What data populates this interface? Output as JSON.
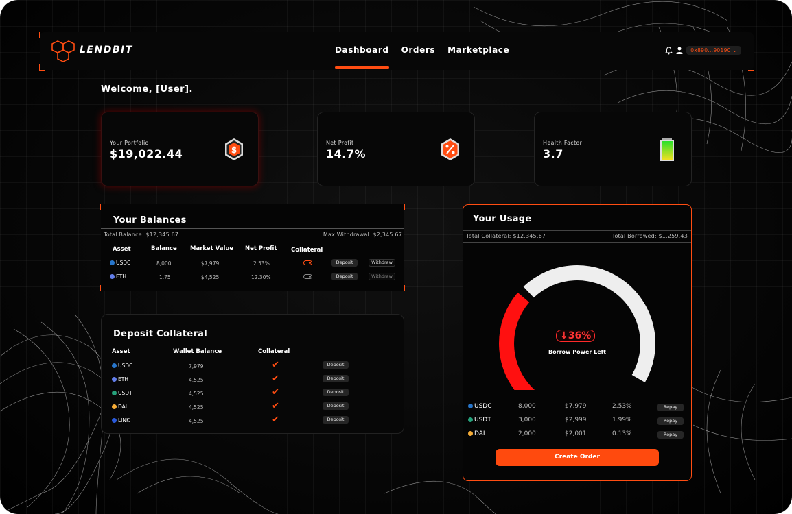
{
  "app": {
    "brand": "LENDBIT"
  },
  "nav": {
    "tabs": [
      {
        "label": "Dashboard"
      },
      {
        "label": "Orders"
      },
      {
        "label": "Marketplace"
      }
    ],
    "wallet": "0x890...90190 ⌄",
    "accent": "#ff4d12"
  },
  "welcome": "Welcome, [User].",
  "stats": {
    "portfolio": {
      "label": "Your Portfolio",
      "value": "$19,022.44",
      "icon": "dollar-hex-icon"
    },
    "profit": {
      "label": "Net Profit",
      "value": "14.7%",
      "icon": "percent-hex-icon"
    },
    "health": {
      "label": "Health Factor",
      "value": "3.7",
      "icon": "battery-icon"
    }
  },
  "balances": {
    "title": "Your Balances",
    "total": "Total Balance: $12,345.67",
    "max": "Max Withdrawal: $2,345.67",
    "headers": [
      "Asset",
      "Balance",
      "Market Value",
      "Net Profit",
      "Collateral"
    ],
    "rows": [
      {
        "asset": "USDC",
        "balance": "8,000",
        "market": "$7,979",
        "profit": "2.53%",
        "collateral_on": true,
        "deposit": "Deposit",
        "withdraw": "Withdraw"
      },
      {
        "asset": "ETH",
        "balance": "1.75",
        "market": "$4,525",
        "profit": "12.30%",
        "collateral_on": false,
        "deposit": "Deposit",
        "withdraw": "Withdraw"
      }
    ]
  },
  "deposit": {
    "title": "Deposit Collateral",
    "headers": [
      "Asset",
      "Wallet Balance",
      "Collateral"
    ],
    "rows": [
      {
        "asset": "USDC",
        "balance": "7,979",
        "btn": "Deposit",
        "color": "#2775ca"
      },
      {
        "asset": "ETH",
        "balance": "4,525",
        "btn": "Deposit",
        "color": "#627eea"
      },
      {
        "asset": "USDT",
        "balance": "4,525",
        "btn": "Deposit",
        "color": "#26a17b"
      },
      {
        "asset": "DAI",
        "balance": "4,525",
        "btn": "Deposit",
        "color": "#f5ac37"
      },
      {
        "asset": "LINK",
        "balance": "4,525",
        "btn": "Deposit",
        "color": "#2a5ada"
      }
    ]
  },
  "usage": {
    "title": "Your Usage",
    "total_collateral": "Total Collateral: $12,345.67",
    "total_borrowed": "Total Borrowed: $1,259.43",
    "badge": "↓36%",
    "gauge_label": "Borrow Power Left",
    "gauge_used_fraction": 0.36,
    "rows": [
      {
        "asset": "USDC",
        "amount": "8,000",
        "value": "$7,979",
        "rate": "2.53%",
        "btn": "Repay",
        "color": "#2775ca"
      },
      {
        "asset": "USDT",
        "amount": "3,000",
        "value": "$2,999",
        "rate": "1.99%",
        "btn": "Repay",
        "color": "#26a17b"
      },
      {
        "asset": "DAI",
        "amount": "2,000",
        "value": "$2,001",
        "rate": "0.13%",
        "btn": "Repay",
        "color": "#f5ac37"
      }
    ],
    "create": "Create Order"
  }
}
